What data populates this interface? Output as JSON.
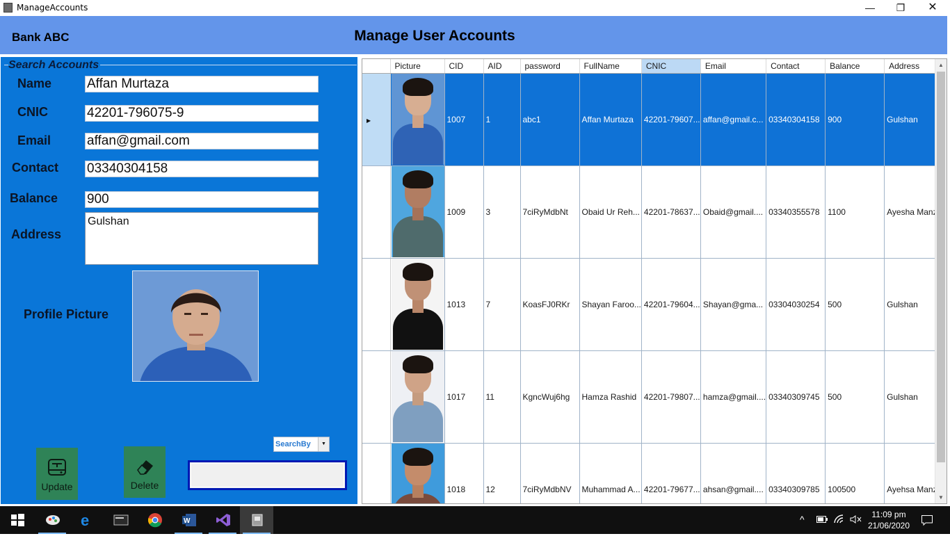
{
  "window": {
    "title": "ManageAccounts",
    "min_icon": "minimize-icon",
    "max_icon": "maximize-icon",
    "close_icon": "close-icon"
  },
  "header": {
    "bank": "Bank ABC",
    "title": "Manage User Accounts"
  },
  "search_panel": {
    "group_title": "Search Accounts",
    "labels": {
      "name": "Name",
      "cnic": "CNIC",
      "email": "Email",
      "contact": "Contact",
      "balance": "Balance",
      "address": "Address",
      "picture": "Profile Picture"
    },
    "values": {
      "name": "Affan Murtaza",
      "cnic": "42201-796075-9",
      "email": "affan@gmail.com",
      "contact": "03340304158",
      "balance": "900",
      "address": "Gulshan"
    },
    "search_by": "SearchBy",
    "search_text": "",
    "update_label": "Update",
    "delete_label": "Delete"
  },
  "grid": {
    "columns": [
      "Picture",
      "CID",
      "AID",
      "password",
      "FullName",
      "CNIC",
      "Email",
      "Contact",
      "Balance",
      "Address"
    ],
    "sorted_column": "CNIC",
    "rows": [
      {
        "cid": "1007",
        "aid": "1",
        "password": "abc1",
        "fullname": "Affan Murtaza",
        "cnic": "42201-79607...",
        "email": "affan@gmail.c...",
        "contact": "03340304158",
        "balance": "900",
        "address": "Gulshan"
      },
      {
        "cid": "1009",
        "aid": "3",
        "password": "7ciRyMdbNt",
        "fullname": "Obaid Ur Reh...",
        "cnic": "42201-78637...",
        "email": "Obaid@gmail....",
        "contact": "03340355578",
        "balance": "1100",
        "address": "Ayesha Manzil"
      },
      {
        "cid": "1013",
        "aid": "7",
        "password": "KoasFJ0RKr",
        "fullname": "Shayan Faroo...",
        "cnic": "42201-79604...",
        "email": "Shayan@gma...",
        "contact": "03304030254",
        "balance": "500",
        "address": "Gulshan"
      },
      {
        "cid": "1017",
        "aid": "11",
        "password": "KgncWuj6hg",
        "fullname": "Hamza Rashid",
        "cnic": "42201-79807...",
        "email": "hamza@gmail....",
        "contact": "03340309745",
        "balance": "500",
        "address": "Gulshan"
      },
      {
        "cid": "1018",
        "aid": "12",
        "password": "7ciRyMdbNV",
        "fullname": "Muhammad A...",
        "cnic": "42201-79677...",
        "email": "ahsan@gmail....",
        "contact": "03340309785",
        "balance": "100500",
        "address": "Ayehsa Manzil"
      }
    ]
  },
  "taskbar": {
    "items": [
      "start-icon",
      "paint-icon",
      "edge-icon",
      "terminal-icon",
      "chrome-icon",
      "word-icon",
      "visual-studio-icon",
      "manageaccounts-app-icon"
    ],
    "time": "11:09 pm",
    "date": "21/06/2020"
  },
  "colors": {
    "header": "#6395ea",
    "panel": "#0a76d8",
    "selection": "#0f72d6",
    "button": "#2f8357"
  }
}
